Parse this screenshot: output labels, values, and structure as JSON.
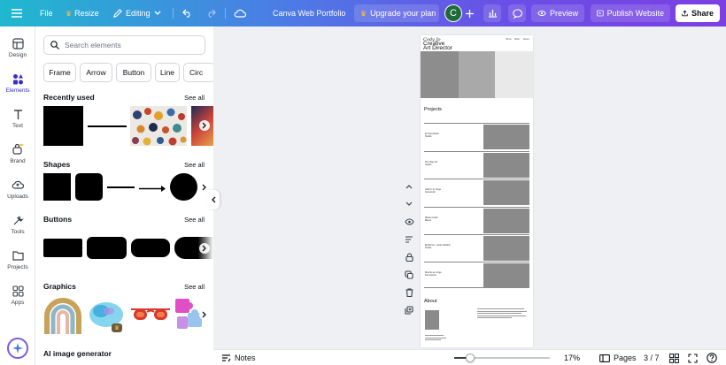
{
  "topbar": {
    "file": "File",
    "resize": "Resize",
    "editing": "Editing",
    "doc_title": "Canva Web Portfolio",
    "upgrade": "Upgrade your plan",
    "avatar_initial": "C",
    "preview": "Preview",
    "publish": "Publish Website",
    "share": "Share"
  },
  "rail": [
    {
      "label": "Design",
      "icon": "design-icon"
    },
    {
      "label": "Elements",
      "icon": "elements-icon"
    },
    {
      "label": "Text",
      "icon": "text-icon"
    },
    {
      "label": "Brand",
      "icon": "brand-icon"
    },
    {
      "label": "Uploads",
      "icon": "uploads-icon"
    },
    {
      "label": "Tools",
      "icon": "tools-icon"
    },
    {
      "label": "Projects",
      "icon": "projects-icon"
    },
    {
      "label": "Apps",
      "icon": "apps-icon"
    }
  ],
  "panel": {
    "search_placeholder": "Search elements",
    "chips": [
      "Frame",
      "Arrow",
      "Button",
      "Line",
      "Circ"
    ],
    "see_all": "See all",
    "recently_used": "Recently used",
    "shapes": "Shapes",
    "buttons": "Buttons",
    "graphics": "Graphics",
    "ai_generator": "AI image generator"
  },
  "page": {
    "logo": "Cody Jo",
    "title_line1": "Creative",
    "title_line2": "Art Director",
    "nav": [
      "Home",
      "Work",
      "About"
    ],
    "projects_heading": "Projects",
    "about_heading": "About",
    "projects": [
      {
        "title_line1": "El Greenback",
        "title_line2": "Studio"
      },
      {
        "title_line1": "The Stay Art",
        "title_line2": "Studio"
      },
      {
        "title_line1": "Garton at Jorge",
        "title_line2": "Santander"
      },
      {
        "title_line1": "Milano Fashi",
        "title_line2": "Memo"
      },
      {
        "title_line1": "MASH Hi + Rose Madrid",
        "title_line2": "Studio"
      },
      {
        "title_line1": "Mondo as Jorge",
        "title_line2": "Permission"
      }
    ]
  },
  "bottombar": {
    "notes": "Notes",
    "zoom": "17%",
    "zoom_fraction": 0.17,
    "pages_label": "Pages",
    "page_counter": "3 / 7"
  },
  "colors": {
    "accent": "#7b3fe4",
    "active_rail": "#3b2fc7",
    "avatar": "#1e6b3a"
  }
}
